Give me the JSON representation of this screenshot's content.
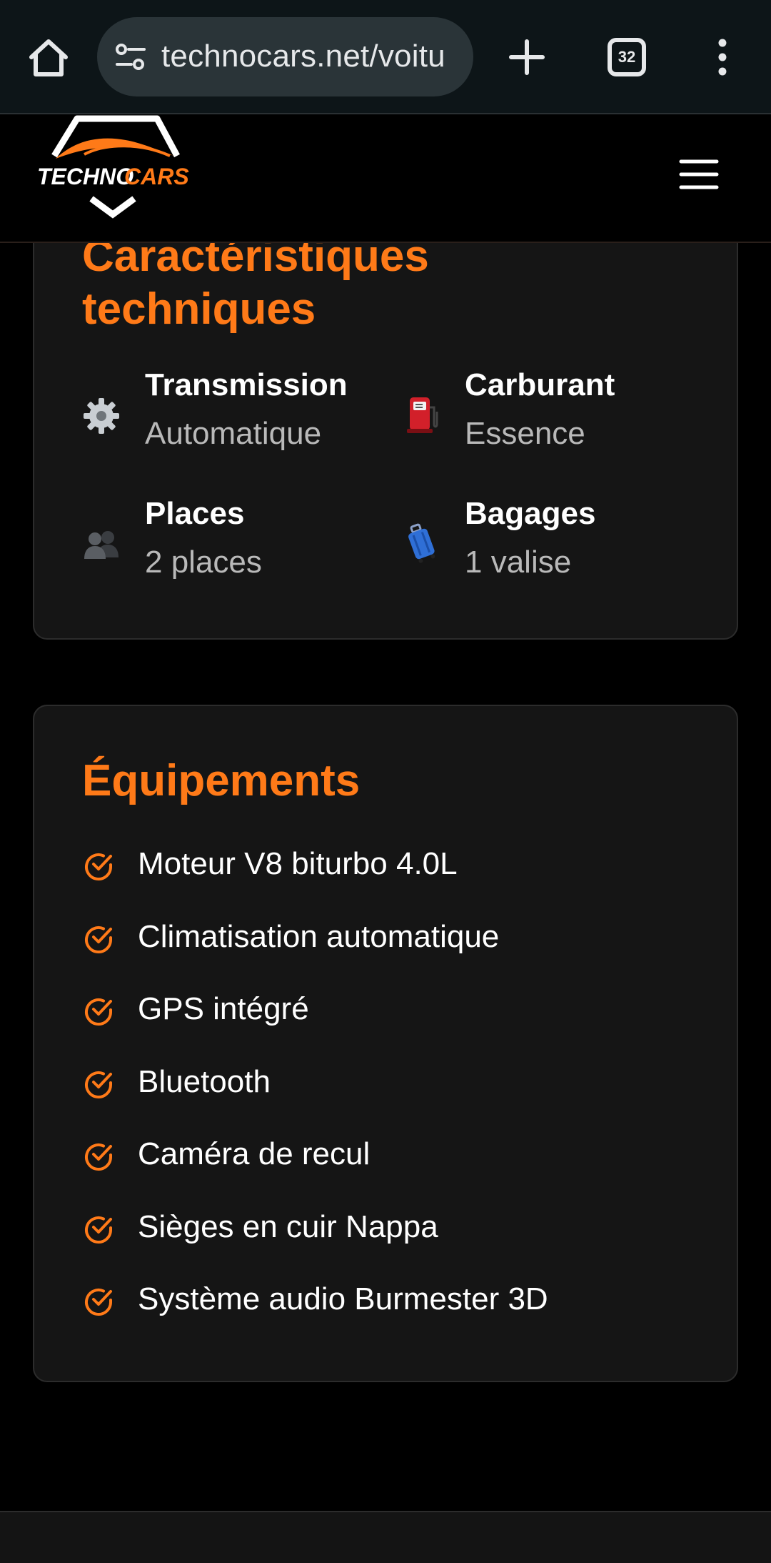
{
  "browser": {
    "url": "technocars.net/voitu",
    "tab_count": "32"
  },
  "site": {
    "logo_text_white": "TECHNO",
    "logo_text_orange": "CARS"
  },
  "specs": {
    "title": "Caractéristiques techniques",
    "items": [
      {
        "label": "Transmission",
        "value": "Automatique",
        "icon": "gear-icon"
      },
      {
        "label": "Carburant",
        "value": "Essence",
        "icon": "fuel-pump-icon"
      },
      {
        "label": "Places",
        "value": "2 places",
        "icon": "people-icon"
      },
      {
        "label": "Bagages",
        "value": "1 valise",
        "icon": "luggage-icon"
      }
    ]
  },
  "equipment": {
    "title": "Équipements",
    "items": [
      "Moteur V8 biturbo 4.0L",
      "Climatisation automatique",
      "GPS intégré",
      "Bluetooth",
      "Caméra de recul",
      "Sièges en cuir Nappa",
      "Système audio Burmester 3D"
    ]
  },
  "colors": {
    "accent": "#ff7a18",
    "card_bg": "#151515",
    "page_bg": "#000000",
    "chrome_bg": "#0d1518"
  }
}
